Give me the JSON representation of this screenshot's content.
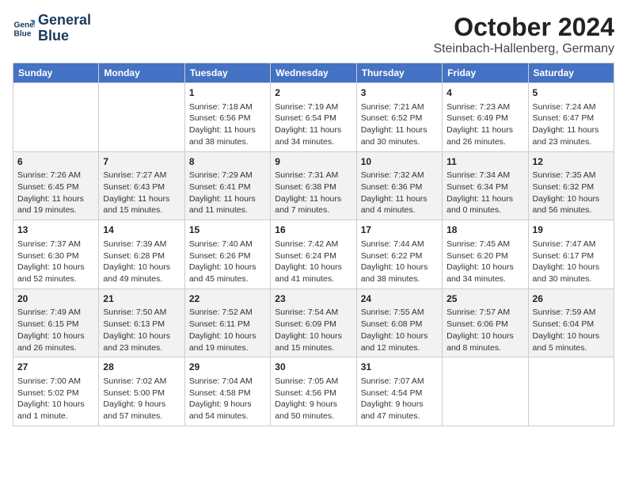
{
  "logo": {
    "line1": "General",
    "line2": "Blue"
  },
  "title": "October 2024",
  "location": "Steinbach-Hallenberg, Germany",
  "headers": [
    "Sunday",
    "Monday",
    "Tuesday",
    "Wednesday",
    "Thursday",
    "Friday",
    "Saturday"
  ],
  "weeks": [
    [
      {
        "day": "",
        "info": ""
      },
      {
        "day": "",
        "info": ""
      },
      {
        "day": "1",
        "info": "Sunrise: 7:18 AM\nSunset: 6:56 PM\nDaylight: 11 hours and 38 minutes."
      },
      {
        "day": "2",
        "info": "Sunrise: 7:19 AM\nSunset: 6:54 PM\nDaylight: 11 hours and 34 minutes."
      },
      {
        "day": "3",
        "info": "Sunrise: 7:21 AM\nSunset: 6:52 PM\nDaylight: 11 hours and 30 minutes."
      },
      {
        "day": "4",
        "info": "Sunrise: 7:23 AM\nSunset: 6:49 PM\nDaylight: 11 hours and 26 minutes."
      },
      {
        "day": "5",
        "info": "Sunrise: 7:24 AM\nSunset: 6:47 PM\nDaylight: 11 hours and 23 minutes."
      }
    ],
    [
      {
        "day": "6",
        "info": "Sunrise: 7:26 AM\nSunset: 6:45 PM\nDaylight: 11 hours and 19 minutes."
      },
      {
        "day": "7",
        "info": "Sunrise: 7:27 AM\nSunset: 6:43 PM\nDaylight: 11 hours and 15 minutes."
      },
      {
        "day": "8",
        "info": "Sunrise: 7:29 AM\nSunset: 6:41 PM\nDaylight: 11 hours and 11 minutes."
      },
      {
        "day": "9",
        "info": "Sunrise: 7:31 AM\nSunset: 6:38 PM\nDaylight: 11 hours and 7 minutes."
      },
      {
        "day": "10",
        "info": "Sunrise: 7:32 AM\nSunset: 6:36 PM\nDaylight: 11 hours and 4 minutes."
      },
      {
        "day": "11",
        "info": "Sunrise: 7:34 AM\nSunset: 6:34 PM\nDaylight: 11 hours and 0 minutes."
      },
      {
        "day": "12",
        "info": "Sunrise: 7:35 AM\nSunset: 6:32 PM\nDaylight: 10 hours and 56 minutes."
      }
    ],
    [
      {
        "day": "13",
        "info": "Sunrise: 7:37 AM\nSunset: 6:30 PM\nDaylight: 10 hours and 52 minutes."
      },
      {
        "day": "14",
        "info": "Sunrise: 7:39 AM\nSunset: 6:28 PM\nDaylight: 10 hours and 49 minutes."
      },
      {
        "day": "15",
        "info": "Sunrise: 7:40 AM\nSunset: 6:26 PM\nDaylight: 10 hours and 45 minutes."
      },
      {
        "day": "16",
        "info": "Sunrise: 7:42 AM\nSunset: 6:24 PM\nDaylight: 10 hours and 41 minutes."
      },
      {
        "day": "17",
        "info": "Sunrise: 7:44 AM\nSunset: 6:22 PM\nDaylight: 10 hours and 38 minutes."
      },
      {
        "day": "18",
        "info": "Sunrise: 7:45 AM\nSunset: 6:20 PM\nDaylight: 10 hours and 34 minutes."
      },
      {
        "day": "19",
        "info": "Sunrise: 7:47 AM\nSunset: 6:17 PM\nDaylight: 10 hours and 30 minutes."
      }
    ],
    [
      {
        "day": "20",
        "info": "Sunrise: 7:49 AM\nSunset: 6:15 PM\nDaylight: 10 hours and 26 minutes."
      },
      {
        "day": "21",
        "info": "Sunrise: 7:50 AM\nSunset: 6:13 PM\nDaylight: 10 hours and 23 minutes."
      },
      {
        "day": "22",
        "info": "Sunrise: 7:52 AM\nSunset: 6:11 PM\nDaylight: 10 hours and 19 minutes."
      },
      {
        "day": "23",
        "info": "Sunrise: 7:54 AM\nSunset: 6:09 PM\nDaylight: 10 hours and 15 minutes."
      },
      {
        "day": "24",
        "info": "Sunrise: 7:55 AM\nSunset: 6:08 PM\nDaylight: 10 hours and 12 minutes."
      },
      {
        "day": "25",
        "info": "Sunrise: 7:57 AM\nSunset: 6:06 PM\nDaylight: 10 hours and 8 minutes."
      },
      {
        "day": "26",
        "info": "Sunrise: 7:59 AM\nSunset: 6:04 PM\nDaylight: 10 hours and 5 minutes."
      }
    ],
    [
      {
        "day": "27",
        "info": "Sunrise: 7:00 AM\nSunset: 5:02 PM\nDaylight: 10 hours and 1 minute."
      },
      {
        "day": "28",
        "info": "Sunrise: 7:02 AM\nSunset: 5:00 PM\nDaylight: 9 hours and 57 minutes."
      },
      {
        "day": "29",
        "info": "Sunrise: 7:04 AM\nSunset: 4:58 PM\nDaylight: 9 hours and 54 minutes."
      },
      {
        "day": "30",
        "info": "Sunrise: 7:05 AM\nSunset: 4:56 PM\nDaylight: 9 hours and 50 minutes."
      },
      {
        "day": "31",
        "info": "Sunrise: 7:07 AM\nSunset: 4:54 PM\nDaylight: 9 hours and 47 minutes."
      },
      {
        "day": "",
        "info": ""
      },
      {
        "day": "",
        "info": ""
      }
    ]
  ]
}
